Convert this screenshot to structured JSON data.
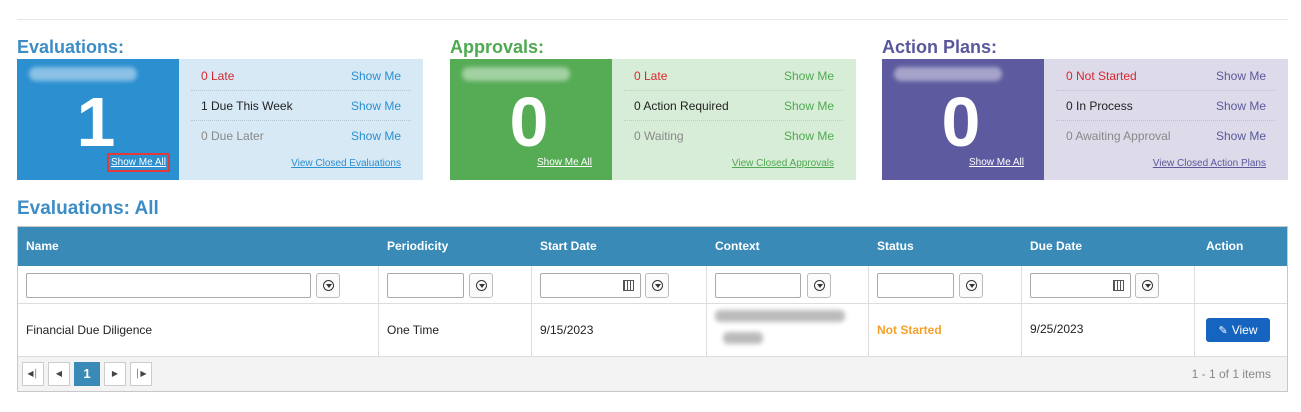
{
  "widgets": {
    "evaluations": {
      "title": "Evaluations:",
      "count": "1",
      "show_all": "Show Me All",
      "rows": [
        {
          "label": "0 Late",
          "link": "Show Me"
        },
        {
          "label": "1 Due This Week",
          "link": "Show Me"
        },
        {
          "label": "0 Due Later",
          "link": "Show Me"
        }
      ],
      "closed_link": "View Closed Evaluations",
      "colors": {
        "title": "#3c8dc5",
        "big": "#2b8fd0",
        "panel": "#d6e9f5",
        "link": "#2b8fd0"
      }
    },
    "approvals": {
      "title": "Approvals:",
      "count": "0",
      "show_all": "Show Me All",
      "rows": [
        {
          "label": "0 Late",
          "link": "Show Me"
        },
        {
          "label": "0 Action Required",
          "link": "Show Me"
        },
        {
          "label": "0 Waiting",
          "link": "Show Me"
        }
      ],
      "closed_link": "View Closed Approvals",
      "colors": {
        "title": "#4ea951",
        "big": "#56ab55",
        "panel": "#d8edd7",
        "link": "#4ea951"
      }
    },
    "action_plans": {
      "title": "Action Plans:",
      "count": "0",
      "show_all": "Show Me All",
      "rows": [
        {
          "label": "0 Not Started",
          "link": "Show Me"
        },
        {
          "label": "0 In Process",
          "link": "Show Me"
        },
        {
          "label": "0 Awaiting Approval",
          "link": "Show Me"
        }
      ],
      "closed_link": "View Closed Action Plans",
      "colors": {
        "title": "#5a589b",
        "big": "#5d5a9f",
        "panel": "#dddbe9",
        "link": "#5a589b"
      }
    }
  },
  "section": {
    "title": "Evaluations: All"
  },
  "table": {
    "columns": [
      "Name",
      "Periodicity",
      "Start Date",
      "Context",
      "Status",
      "Due Date",
      "Action"
    ],
    "rows": [
      {
        "name": "Financial Due Diligence",
        "periodicity": "One Time",
        "start_date": "9/15/2023",
        "status": "Not Started",
        "due_date": "9/25/2023",
        "action": "View"
      }
    ],
    "pager": {
      "current_page": "1",
      "info": "1 - 1 of 1 items"
    }
  },
  "icons": {
    "filter": "filter-icon",
    "calendar": "calendar-icon",
    "edit": "edit-icon"
  }
}
